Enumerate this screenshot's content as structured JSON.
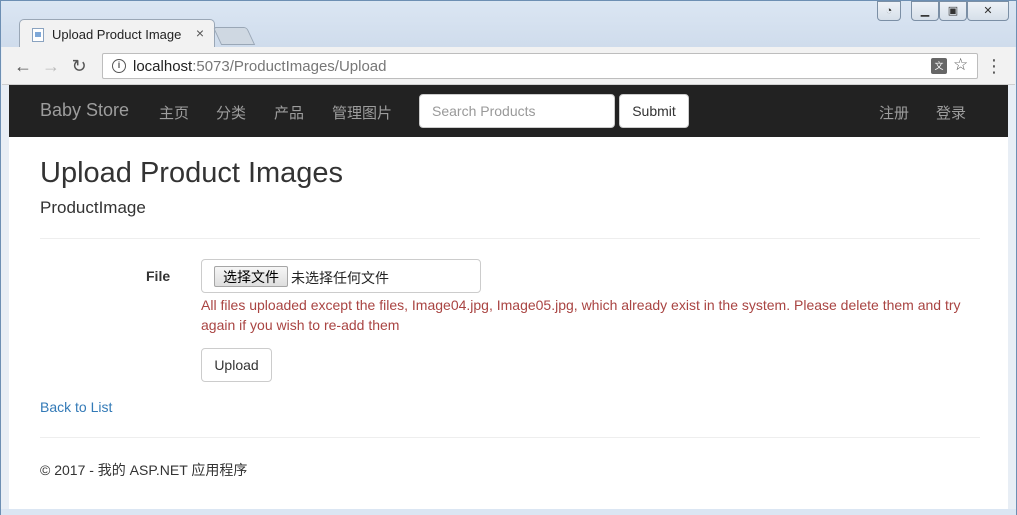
{
  "browser": {
    "tab_title": "Upload Product Image",
    "url_host": "localhost",
    "url_rest": ":5073/ProductImages/Upload"
  },
  "navbar": {
    "brand": "Baby Store",
    "links": [
      "主页",
      "分类",
      "产品",
      "管理图片"
    ],
    "search_placeholder": "Search Products",
    "submit_label": "Submit",
    "right_links": [
      "注册",
      "登录"
    ]
  },
  "main": {
    "title": "Upload Product Images",
    "subtitle": "ProductImage",
    "file_label": "File",
    "choose_file_label": "选择文件",
    "no_file_text": "未选择任何文件",
    "error_message": "All files uploaded except the files, Image04.jpg, Image05.jpg, which already exist in the system. Please delete them and try again if you wish to re-add them",
    "upload_label": "Upload",
    "back_link": "Back to List"
  },
  "footer": {
    "text": "© 2017 - 我的 ASP.NET 应用程序"
  },
  "colors": {
    "navbar_bg": "#222222",
    "error": "#a94442",
    "link": "#337ab7"
  }
}
